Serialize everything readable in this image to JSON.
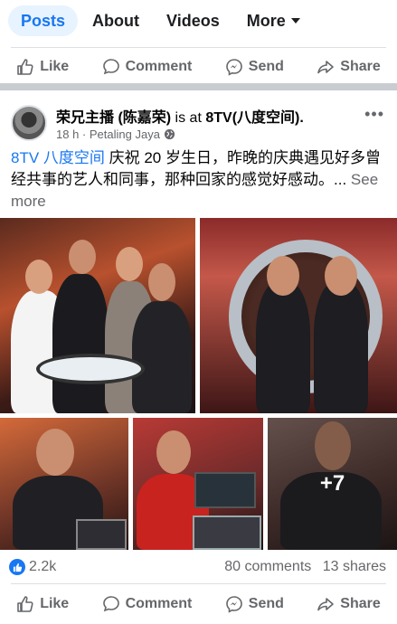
{
  "tabs": [
    {
      "label": "Posts",
      "active": true
    },
    {
      "label": "About"
    },
    {
      "label": "Videos"
    },
    {
      "label": "More"
    }
  ],
  "actions": {
    "like": "Like",
    "comment": "Comment",
    "send": "Send",
    "share": "Share"
  },
  "post": {
    "author": "荣兄主播 (陈嘉荣)",
    "is_at": " is at ",
    "place": "8TV(八度空间).",
    "time": "18 h",
    "location": "Petaling Jaya",
    "tag": "8TV 八度空间",
    "text": " 庆祝 20 岁生日，昨晚的庆典遇见好多曾经共事的艺人和同事，那种回家的感觉好感动。...",
    "see_more": "See more",
    "more_photos": "+7"
  },
  "stats": {
    "likes": "2.2k",
    "comments": "80 comments",
    "shares": "13 shares"
  },
  "colors": {
    "accent": "#1877f2",
    "muted": "#65676b"
  }
}
